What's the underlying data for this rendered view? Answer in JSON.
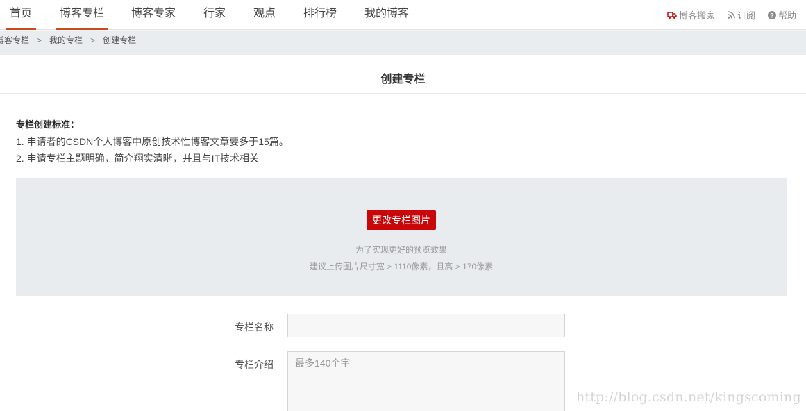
{
  "nav": {
    "items": [
      {
        "label": "首页",
        "active": true
      },
      {
        "label": "博客专栏",
        "active": true
      },
      {
        "label": "博客专家",
        "active": false
      },
      {
        "label": "行家",
        "active": false
      },
      {
        "label": "观点",
        "active": false
      },
      {
        "label": "排行榜",
        "active": false
      },
      {
        "label": "我的博客",
        "active": false
      }
    ],
    "right_links": [
      {
        "label": "博客搬家",
        "icon": "truck-icon"
      },
      {
        "label": "订阅",
        "icon": "rss-icon"
      },
      {
        "label": "帮助",
        "icon": "help-icon"
      }
    ],
    "accent_color": "#ca4a1f"
  },
  "breadcrumb": {
    "items": [
      "博客专栏",
      "我的专栏",
      "创建专栏"
    ],
    "separator": ">"
  },
  "page": {
    "title": "创建专栏"
  },
  "standards": {
    "heading": "专栏创建标准：",
    "rules": [
      "1. 申请者的CSDN个人博客中原创技术性博客文章要多于15篇。",
      "2. 申请专栏主题明确，简介翔实清晰，并且与IT技术相关"
    ]
  },
  "image_upload": {
    "button_label": "更改专栏图片",
    "hint_line1": "为了实现更好的预览效果",
    "hint_line2": "建议上传图片尺寸宽 > 1110像素，且高 > 170像素",
    "button_color": "#c9070a"
  },
  "form": {
    "name_label": "专栏名称",
    "name_value": "",
    "intro_label": "专栏介绍",
    "intro_placeholder": "最多140个字"
  },
  "watermark": "http://blog.csdn.net/kingscoming"
}
